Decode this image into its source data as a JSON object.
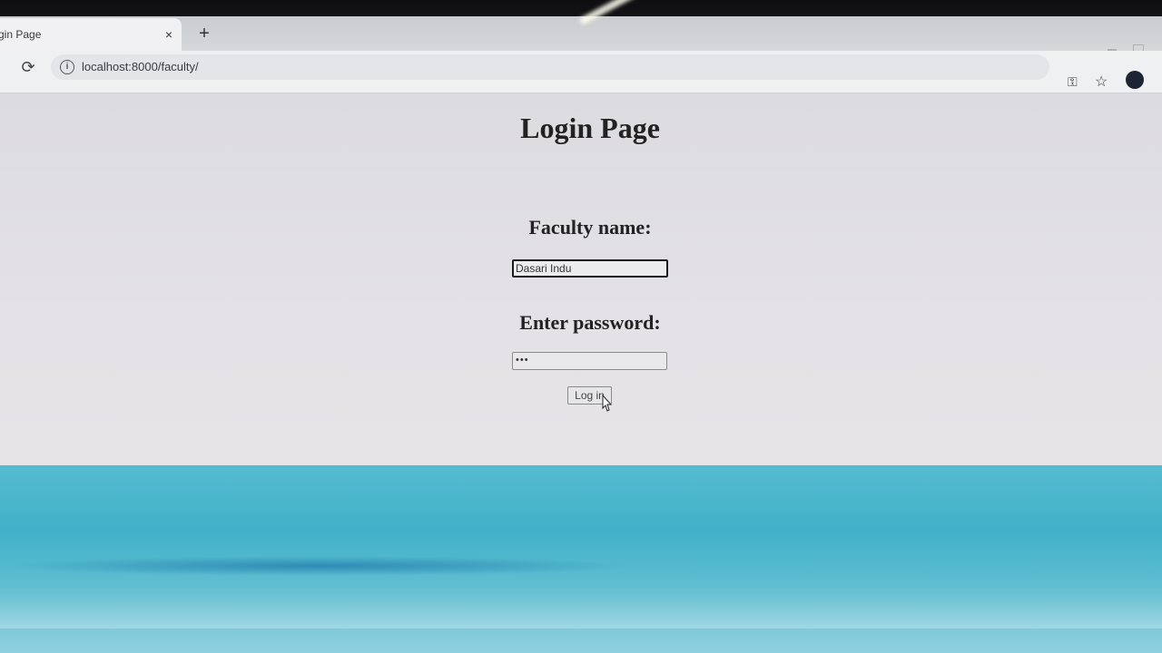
{
  "browser": {
    "tab_title": "gin Page",
    "tab_close": "×",
    "new_tab": "+",
    "url": "localhost:8000/faculty/"
  },
  "page": {
    "title": "Login Page",
    "faculty_label": "Faculty name:",
    "faculty_value": "Dasari Indu",
    "password_label": "Enter password:",
    "password_value": "•••",
    "login_button": "Log in"
  }
}
